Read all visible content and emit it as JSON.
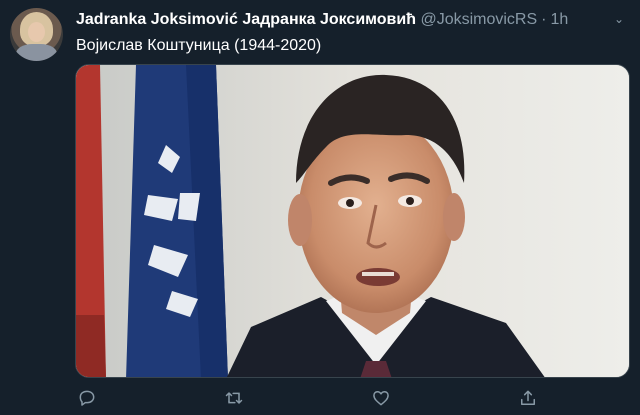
{
  "tweet": {
    "author_name": "Jadranka Joksimović Јадранка Јоксимовић",
    "handle": "@JoksimovicRS",
    "separator": "·",
    "time": "1h",
    "text": "Војислав Коштуница (1944-2020)"
  },
  "actions": [
    {
      "icon": "reply-icon"
    },
    {
      "icon": "retweet-icon"
    },
    {
      "icon": "like-icon"
    },
    {
      "icon": "share-icon"
    }
  ],
  "colors": {
    "background": "#15202b",
    "secondary_text": "#8899a6",
    "primary_text": "#ffffff",
    "border": "#38444d"
  }
}
